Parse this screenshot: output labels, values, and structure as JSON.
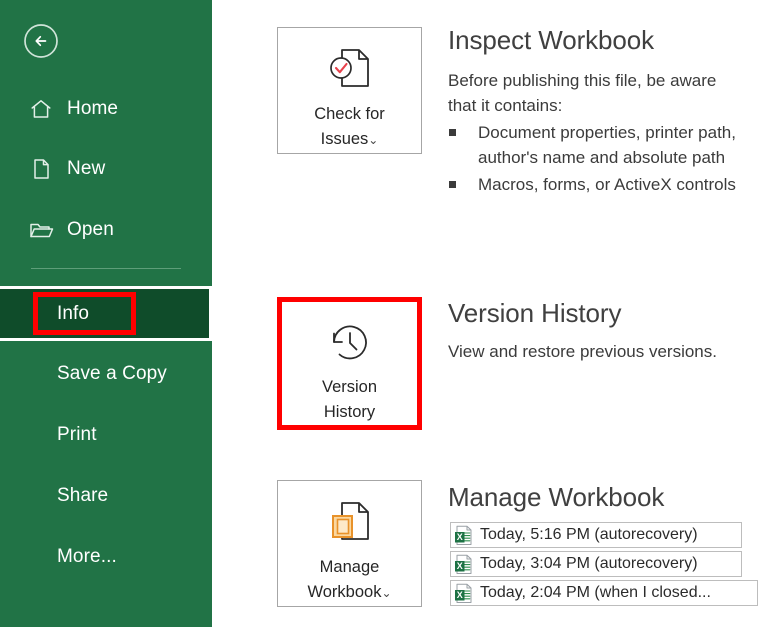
{
  "app": {
    "accent_green": "#217346",
    "selected_green": "#0f4c2a",
    "annotation_red": "#ff0000"
  },
  "sidebar": {
    "back_label": "Back",
    "items": [
      {
        "label": "Home",
        "icon": "home-icon"
      },
      {
        "label": "New",
        "icon": "new-document-icon"
      },
      {
        "label": "Open",
        "icon": "open-folder-icon"
      },
      {
        "label": "Info",
        "icon": "info-item"
      },
      {
        "label": "Save a Copy",
        "icon": "save-copy-item"
      },
      {
        "label": "Print",
        "icon": "print-item"
      },
      {
        "label": "Share",
        "icon": "share-item"
      },
      {
        "label": "More...",
        "icon": "more-item"
      }
    ]
  },
  "main": {
    "inspect": {
      "button_label_line1": "Check for",
      "button_label_line2": "Issues",
      "button_caret": "⌄",
      "title": "Inspect Workbook",
      "body": "Before publishing this file, be aware that it contains:",
      "bullets": [
        "Document properties, printer path, author's name and absolute path",
        "Macros, forms, or ActiveX controls"
      ]
    },
    "version_history": {
      "button_label_line1": "Version",
      "button_label_line2": "History",
      "title": "Version History",
      "body": "View and restore previous versions."
    },
    "manage_workbook": {
      "button_label_line1": "Manage",
      "button_label_line2": "Workbook",
      "button_caret": "⌄",
      "title": "Manage Workbook",
      "recovery_items": [
        {
          "label": "Today, 5:16 PM (autorecovery)"
        },
        {
          "label": "Today, 3:04 PM (autorecovery)"
        },
        {
          "label": "Today, 2:04 PM (when I closed..."
        }
      ]
    }
  }
}
